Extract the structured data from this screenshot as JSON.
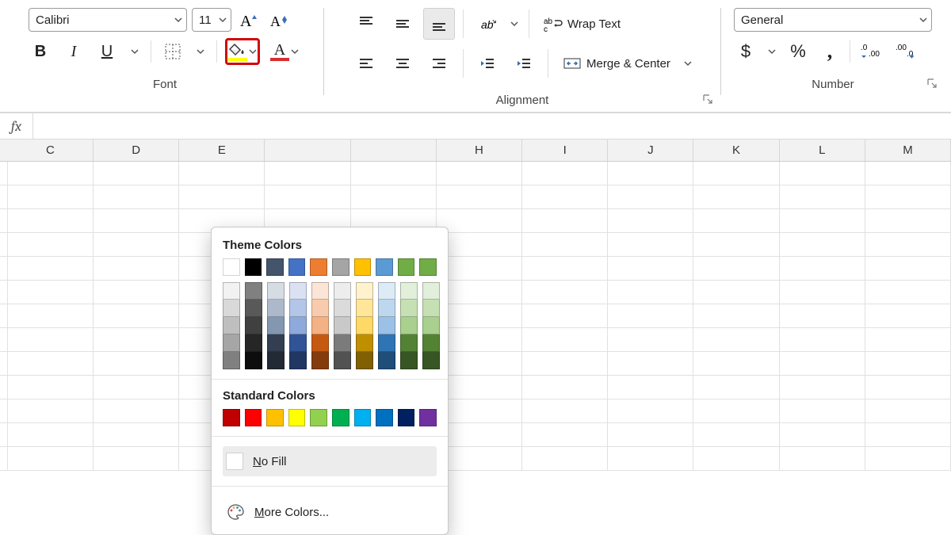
{
  "font": {
    "name": "Calibri",
    "size": "11",
    "group_label": "Font"
  },
  "alignment": {
    "wrap_text": "Wrap Text",
    "merge_center": "Merge & Center",
    "group_label": "Alignment"
  },
  "number": {
    "format": "General",
    "group_label": "Number",
    "currency": "$",
    "percent": "%",
    "comma": ","
  },
  "columns": [
    "C",
    "D",
    "E",
    "",
    "",
    "H",
    "I",
    "J",
    "K",
    "L",
    "M"
  ],
  "colors": {
    "theme_label": "Theme Colors",
    "standard_label": "Standard Colors",
    "no_fill": "No Fill",
    "more_colors": "More Colors...",
    "theme_top": [
      "#FFFFFF",
      "#000000",
      "#44546A",
      "#4472C4",
      "#ED7D31",
      "#A5A5A5",
      "#FFC000",
      "#5B9BD5",
      "#70AD47",
      "#70AD47"
    ],
    "theme_shades": [
      [
        "#F2F2F2",
        "#D9D9D9",
        "#BFBFBF",
        "#A6A6A6",
        "#808080"
      ],
      [
        "#808080",
        "#595959",
        "#404040",
        "#262626",
        "#0D0D0D"
      ],
      [
        "#D6DCE4",
        "#ADB9CA",
        "#8497B0",
        "#333F50",
        "#222A35"
      ],
      [
        "#D9E1F2",
        "#B4C6E7",
        "#8EA9DB",
        "#305496",
        "#203764"
      ],
      [
        "#FBE5D6",
        "#F8CBAD",
        "#F4B183",
        "#C65911",
        "#843C0C"
      ],
      [
        "#EDEDED",
        "#DBDBDB",
        "#C9C9C9",
        "#7B7B7B",
        "#525252"
      ],
      [
        "#FFF2CC",
        "#FFE699",
        "#FFD966",
        "#BF8F00",
        "#806000"
      ],
      [
        "#DDEBF7",
        "#BDD7EE",
        "#9BC2E6",
        "#2F75B5",
        "#1F4E78"
      ],
      [
        "#E2EFDA",
        "#C6E0B4",
        "#A9D08E",
        "#548235",
        "#375623"
      ],
      [
        "#E2EFDA",
        "#C6E0B4",
        "#A9D08E",
        "#548235",
        "#375623"
      ]
    ],
    "standard": [
      "#C00000",
      "#FF0000",
      "#FFC000",
      "#FFFF00",
      "#92D050",
      "#00B050",
      "#00B0F0",
      "#0070C0",
      "#002060",
      "#7030A0"
    ]
  },
  "highlight": {
    "fill_underline": "#FFFF00",
    "font_underline": "#D92E2E"
  },
  "fx_label": "fx"
}
